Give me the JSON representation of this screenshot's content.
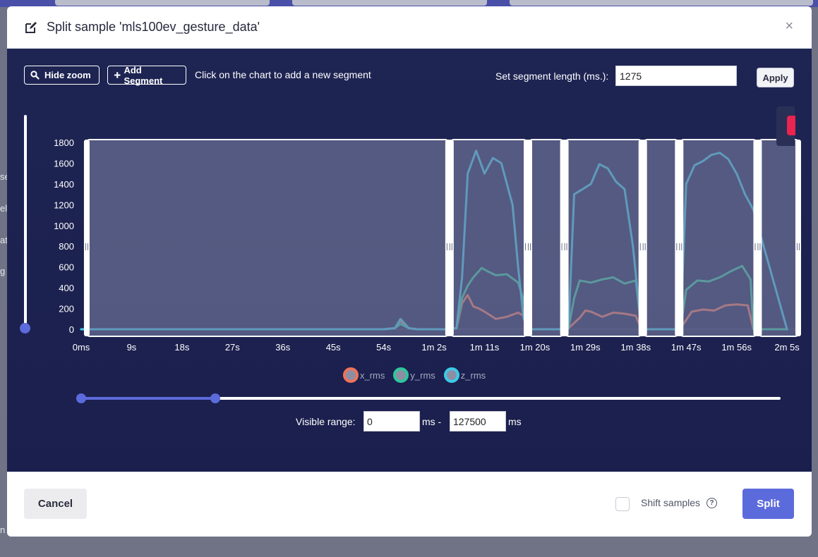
{
  "modal": {
    "title": "Split sample 'mls100ev_gesture_data'",
    "close_symbol": "×"
  },
  "toolbar": {
    "hide_zoom_label": "Hide zoom",
    "add_segment_label": "Add Segment",
    "hint": "Click on the chart to add a new segment",
    "segment_length_label": "Set segment length (ms.):",
    "segment_length_value": "1275",
    "apply_label": "Apply"
  },
  "background_side_fragments": [
    "se",
    "el",
    "at",
    "g",
    "n"
  ],
  "chart_data": {
    "type": "line",
    "x_unit": "ms",
    "x_range": [
      0,
      127500
    ],
    "ylim": [
      0,
      1800
    ],
    "y_ticks": [
      0,
      200,
      400,
      600,
      800,
      1000,
      1200,
      1400,
      1600,
      1800
    ],
    "x_tick_values": [
      0,
      9000,
      18000,
      27000,
      36000,
      45000,
      54000,
      63000,
      72000,
      81000,
      90000,
      99000,
      108000,
      117000,
      126000
    ],
    "x_tick_labels": [
      "0ms",
      "9s",
      "18s",
      "27s",
      "36s",
      "45s",
      "54s",
      "1m 2s",
      "1m 11s",
      "1m 20s",
      "1m 29s",
      "1m 38s",
      "1m 47s",
      "1m 56s",
      "2m 5s"
    ],
    "segments_ms": [
      [
        1000,
        65500
      ],
      [
        66000,
        79500
      ],
      [
        80000,
        86000
      ],
      [
        86500,
        100000
      ],
      [
        100500,
        106500
      ],
      [
        107000,
        120500
      ],
      [
        121000,
        128000
      ]
    ],
    "series": [
      {
        "name": "x_rms",
        "color": "#f0735a",
        "x": [
          0,
          50000,
          54000,
          56000,
          57000,
          58500,
          60000,
          65000,
          67000,
          68000,
          69000,
          70000,
          71000,
          72000,
          74000,
          76000,
          78000,
          79000,
          80000,
          86000,
          87000,
          89000,
          90000,
          91000,
          93000,
          95000,
          97000,
          99000,
          100000,
          106000,
          107000,
          109000,
          111000,
          113000,
          115000,
          117000,
          119000,
          120000,
          126000
        ],
        "y": [
          0,
          0,
          0,
          10,
          80,
          10,
          0,
          0,
          10,
          250,
          330,
          220,
          200,
          170,
          100,
          120,
          160,
          130,
          0,
          0,
          10,
          110,
          180,
          170,
          120,
          160,
          150,
          130,
          0,
          0,
          10,
          170,
          190,
          180,
          230,
          240,
          230,
          0,
          0
        ]
      },
      {
        "name": "y_rms",
        "color": "#2fc79b",
        "x": [
          0,
          50000,
          54000,
          56000,
          57000,
          58500,
          60000,
          65000,
          67000,
          68000,
          69000,
          70000,
          71500,
          72500,
          74000,
          76000,
          78000,
          79000,
          80000,
          86000,
          87000,
          88000,
          89000,
          91000,
          93000,
          95000,
          97000,
          99000,
          100000,
          106000,
          107000,
          108000,
          110000,
          112000,
          114000,
          116000,
          118000,
          119500,
          120000,
          126000
        ],
        "y": [
          0,
          0,
          0,
          10,
          50,
          10,
          0,
          0,
          10,
          300,
          420,
          500,
          590,
          560,
          520,
          530,
          450,
          280,
          0,
          0,
          10,
          300,
          470,
          450,
          480,
          500,
          440,
          470,
          0,
          0,
          10,
          380,
          470,
          460,
          500,
          560,
          610,
          480,
          0,
          0
        ]
      },
      {
        "name": "z_rms",
        "color": "#3ccbe8",
        "x": [
          0,
          50000,
          54000,
          56000,
          57000,
          58500,
          60000,
          65000,
          67000,
          68000,
          69000,
          70500,
          72000,
          73500,
          75000,
          77000,
          78000,
          79000,
          80000,
          86000,
          87000,
          88000,
          89500,
          91000,
          92500,
          94000,
          95500,
          97000,
          98500,
          100000,
          106000,
          107000,
          108000,
          109500,
          111000,
          112500,
          114000,
          115500,
          117000,
          118500,
          120000,
          126000
        ],
        "y": [
          0,
          0,
          0,
          10,
          100,
          10,
          0,
          0,
          10,
          500,
          1500,
          1720,
          1500,
          1650,
          1600,
          1200,
          600,
          100,
          0,
          0,
          10,
          1300,
          1350,
          1400,
          1590,
          1550,
          1420,
          1350,
          800,
          0,
          0,
          10,
          1400,
          1580,
          1620,
          1680,
          1700,
          1640,
          1500,
          1300,
          1150,
          0
        ]
      }
    ]
  },
  "legend": {
    "items": [
      {
        "label": "x_rms",
        "color": "#f0735a"
      },
      {
        "label": "y_rms",
        "color": "#2fc79b"
      },
      {
        "label": "z_rms",
        "color": "#3ccbe8"
      }
    ]
  },
  "visible_range": {
    "label": "Visible range:",
    "start_value": "0",
    "separator": "ms -",
    "end_value": "127500",
    "unit": "ms"
  },
  "footer": {
    "cancel_label": "Cancel",
    "shift_samples_label": "Shift samples",
    "help_symbol": "?",
    "split_label": "Split"
  },
  "colors": {
    "accent": "#5c6bdb",
    "chart_background": "#1e2553",
    "segment_fill": "#5f6483"
  }
}
